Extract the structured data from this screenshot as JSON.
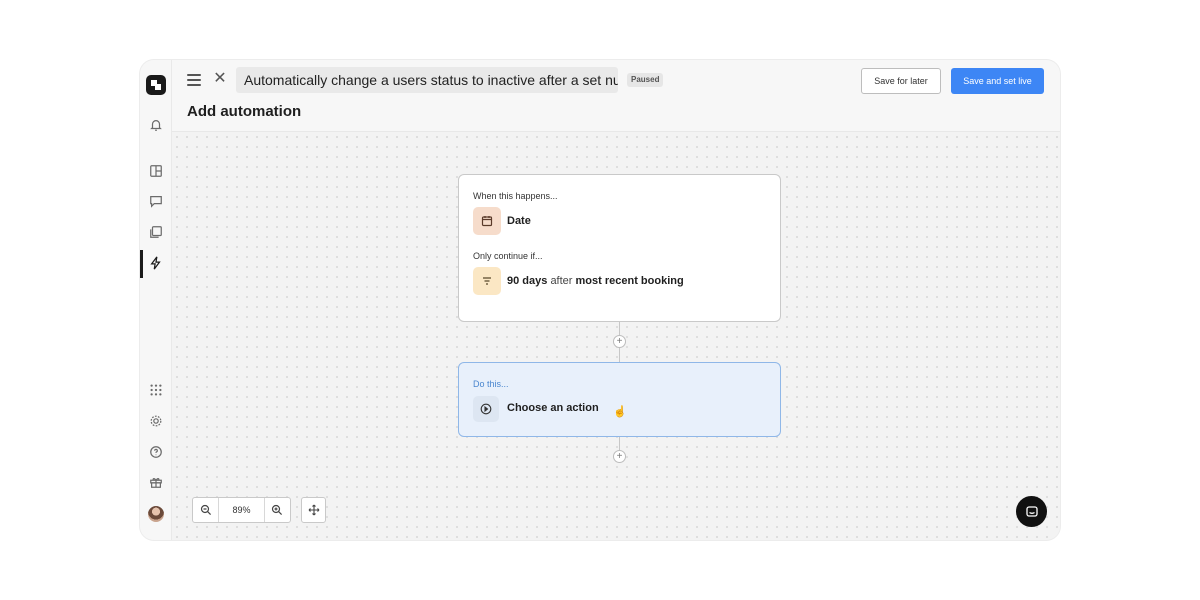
{
  "header": {
    "automation_title": "Automatically change a users status to inactive after a set nu",
    "status_badge": "Paused",
    "save_later_label": "Save for later",
    "save_live_label": "Save and set live",
    "page_title": "Add automation"
  },
  "sidebar": {
    "items": [
      {
        "icon": "bell-icon"
      },
      {
        "icon": "layout-icon"
      },
      {
        "icon": "chat-icon"
      },
      {
        "icon": "copy-icon"
      },
      {
        "icon": "lightning-icon",
        "active": true
      },
      {
        "icon": "apps-grid-icon"
      },
      {
        "icon": "settings-icon"
      },
      {
        "icon": "help-icon"
      },
      {
        "icon": "gift-icon"
      }
    ]
  },
  "trigger": {
    "when_label": "When this happens...",
    "event": "Date",
    "condition_label": "Only continue if...",
    "condition": {
      "amount": "90 days",
      "relation": "after",
      "target": "most recent booking"
    }
  },
  "action": {
    "label": "Do this...",
    "choose": "Choose an action"
  },
  "zoom": {
    "value": "89%"
  },
  "colors": {
    "accent": "#3d86f5",
    "date_icon_bg": "#f6dccb",
    "filter_icon_bg": "#fbe7c4",
    "action_card_bg": "#e8f0fb",
    "action_border": "#8fb7e8"
  }
}
